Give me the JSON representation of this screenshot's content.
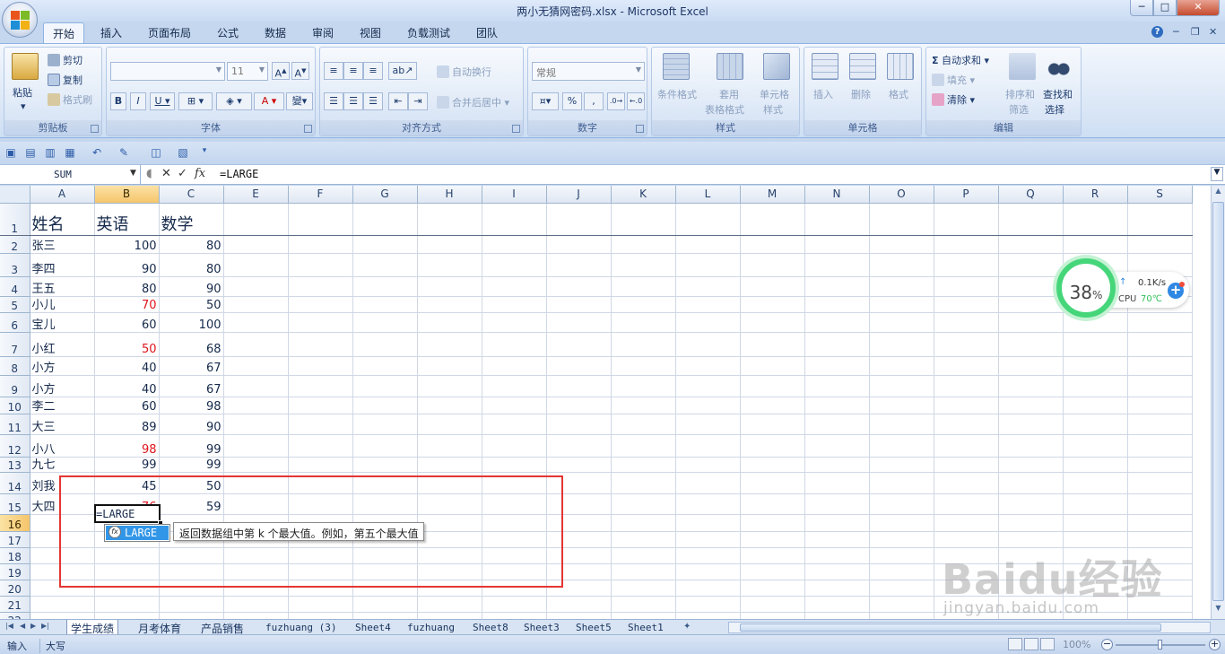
{
  "window": {
    "title": "两小无猜网密码.xlsx - Microsoft Excel",
    "minimize": "─",
    "maximize": "□",
    "close": "✕"
  },
  "tabs": [
    "开始",
    "插入",
    "页面布局",
    "公式",
    "数据",
    "审阅",
    "视图",
    "负载测试",
    "团队"
  ],
  "ribbon": {
    "clipboard": {
      "label": "剪贴板",
      "paste": "粘贴",
      "cut": "剪切",
      "copy": "复制",
      "format_painter": "格式刷"
    },
    "font": {
      "label": "字体",
      "size": "11"
    },
    "alignment": {
      "label": "对齐方式",
      "wrap": "自动换行",
      "merge": "合并后居中"
    },
    "number": {
      "label": "数字",
      "format": "常规"
    },
    "styles": {
      "label": "样式",
      "conditional": "条件格式",
      "table_format_1": "套用",
      "table_format_2": "表格格式",
      "cell_style_1": "单元格",
      "cell_style_2": "样式"
    },
    "cells": {
      "label": "单元格",
      "insert": "插入",
      "delete": "删除",
      "format": "格式"
    },
    "editing": {
      "label": "编辑",
      "autosum": "自动求和",
      "fill": "填充",
      "clear": "清除",
      "sort_1": "排序和",
      "sort_2": "筛选",
      "find_1": "查找和",
      "find_2": "选择"
    }
  },
  "formula_bar": {
    "name_box": "SUM",
    "formula": "=LARGE"
  },
  "columns": [
    "A",
    "B",
    "C",
    "E",
    "F",
    "G",
    "H",
    "I",
    "J",
    "K",
    "L",
    "M",
    "N",
    "O",
    "P",
    "Q",
    "R",
    "S"
  ],
  "rows": [
    {
      "n": "1",
      "a": "姓名",
      "b": "英语",
      "c": "数学",
      "b_red": false
    },
    {
      "n": "2",
      "a": "张三",
      "b": "100",
      "c": "80",
      "b_red": false
    },
    {
      "n": "3",
      "a": "李四",
      "b": "90",
      "c": "80",
      "b_red": false
    },
    {
      "n": "4",
      "a": "王五",
      "b": "80",
      "c": "90",
      "b_red": false
    },
    {
      "n": "5",
      "a": "小儿",
      "b": "70",
      "c": "50",
      "b_red": true
    },
    {
      "n": "6",
      "a": "宝儿",
      "b": "60",
      "c": "100",
      "b_red": false
    },
    {
      "n": "7",
      "a": "小红",
      "b": "50",
      "c": "68",
      "b_red": true
    },
    {
      "n": "8",
      "a": "小方",
      "b": "40",
      "c": "67",
      "b_red": false
    },
    {
      "n": "9",
      "a": "小方",
      "b": "40",
      "c": "67",
      "b_red": false
    },
    {
      "n": "10",
      "a": "李二",
      "b": "60",
      "c": "98",
      "b_red": false
    },
    {
      "n": "11",
      "a": "大三",
      "b": "89",
      "c": "90",
      "b_red": false
    },
    {
      "n": "12",
      "a": "小八",
      "b": "98",
      "c": "99",
      "b_red": true
    },
    {
      "n": "13",
      "a": "九七",
      "b": "99",
      "c": "99",
      "b_red": false
    },
    {
      "n": "14",
      "a": "刘我",
      "b": "45",
      "c": "50",
      "b_red": false
    },
    {
      "n": "15",
      "a": "大四",
      "b": "76",
      "c": "59",
      "b_red": true
    },
    {
      "n": "16",
      "a": "",
      "b": "",
      "c": "",
      "b_red": false
    },
    {
      "n": "17",
      "a": "",
      "b": "",
      "c": "",
      "b_red": false
    },
    {
      "n": "18",
      "a": "",
      "b": "",
      "c": "",
      "b_red": false
    },
    {
      "n": "19",
      "a": "",
      "b": "",
      "c": "",
      "b_red": false
    },
    {
      "n": "20",
      "a": "",
      "b": "",
      "c": "",
      "b_red": false
    },
    {
      "n": "21",
      "a": "",
      "b": "",
      "c": "",
      "b_red": false
    },
    {
      "n": "22",
      "a": "",
      "b": "",
      "c": "",
      "b_red": false
    }
  ],
  "active_cell": {
    "text": "=LARGE"
  },
  "autocomplete": {
    "item": "LARGE",
    "tooltip": "返回数据组中第 k 个最大值。例如，第五个最大值"
  },
  "cpu_widget": {
    "percent": "38",
    "percent_sign": "%",
    "speed": "0.1K/s",
    "label": "CPU",
    "temp": "70℃"
  },
  "watermark": {
    "logo": "Baidu经验",
    "url": "jingyan.baidu.com"
  },
  "sheets": [
    {
      "name": "学生成绩",
      "mono": false,
      "active": true
    },
    {
      "name": "月考体育",
      "mono": false,
      "active": false
    },
    {
      "name": "产品销售",
      "mono": false,
      "active": false
    },
    {
      "name": "fuzhuang (3)",
      "mono": true,
      "active": false
    },
    {
      "name": "Sheet4",
      "mono": true,
      "active": false
    },
    {
      "name": "fuzhuang",
      "mono": true,
      "active": false
    },
    {
      "name": "Sheet8",
      "mono": true,
      "active": false
    },
    {
      "name": "Sheet3",
      "mono": true,
      "active": false
    },
    {
      "name": "Sheet5",
      "mono": true,
      "active": false
    },
    {
      "name": "Sheet1",
      "mono": true,
      "active": false
    }
  ],
  "status": {
    "mode": "输入",
    "caps": "大写",
    "zoom": "100%"
  },
  "colors": {
    "accent": "#3296e8",
    "annotation": "#e43532",
    "negative": "#e0141c"
  }
}
